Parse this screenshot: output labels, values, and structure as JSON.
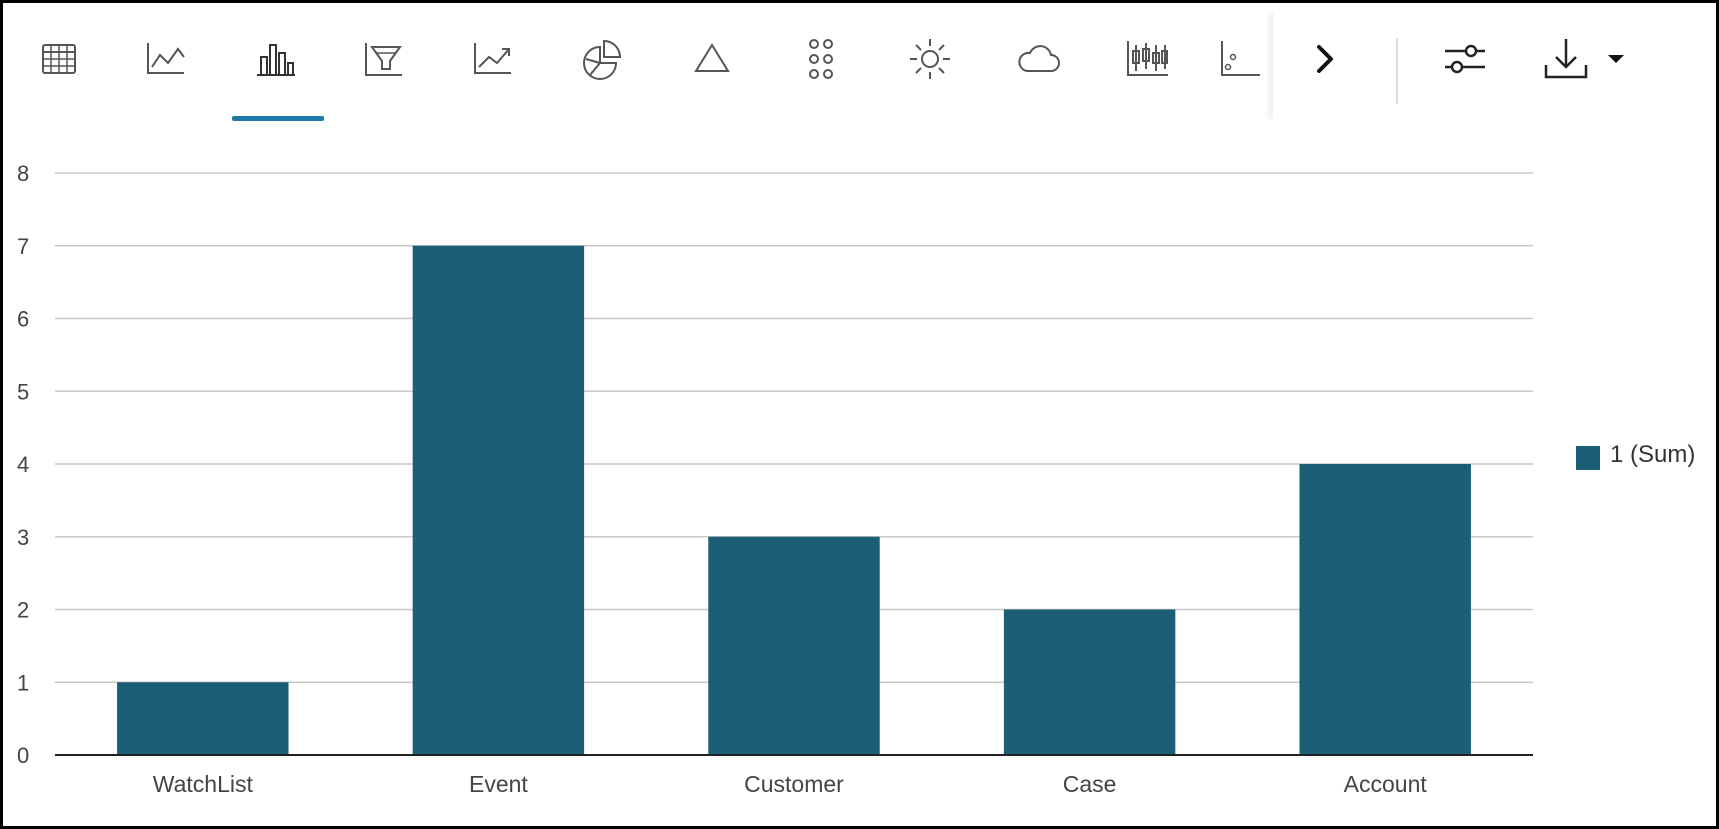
{
  "toolbar": {
    "buttons": [
      {
        "icon": "table-icon",
        "label": "Table"
      },
      {
        "icon": "line-chart-icon",
        "label": "Line"
      },
      {
        "icon": "bar-chart-icon",
        "label": "Bar"
      },
      {
        "icon": "funnel-icon",
        "label": "Funnel"
      },
      {
        "icon": "trend-chart-icon",
        "label": "Trend"
      },
      {
        "icon": "pie-chart-icon",
        "label": "Pie"
      },
      {
        "icon": "pyramid-icon",
        "label": "Pyramid"
      },
      {
        "icon": "dot-grid-icon",
        "label": "Bubble grid"
      },
      {
        "icon": "sunburst-icon",
        "label": "Sunburst"
      },
      {
        "icon": "tag-cloud-icon",
        "label": "Tag cloud"
      },
      {
        "icon": "stock-chart-icon",
        "label": "Stock"
      },
      {
        "icon": "scatter-chart-icon",
        "label": "Scatter"
      }
    ],
    "active": "bar-chart-icon",
    "right_buttons": [
      {
        "icon": "chevron-right-icon"
      },
      {
        "icon": "settings-sliders-icon"
      },
      {
        "icon": "download-icon"
      },
      {
        "icon": "caret-down-icon"
      }
    ]
  },
  "colors": {
    "bar": "#1b5e75",
    "accent": "#1b7aa6",
    "grid": "#c8c8c8",
    "axis": "#222222",
    "icon": "#555555"
  },
  "chart_data": {
    "type": "bar",
    "categories": [
      "WatchList",
      "Event",
      "Customer",
      "Case",
      "Account"
    ],
    "series": [
      {
        "name": "1 (Sum)",
        "values": [
          1,
          7,
          3,
          2,
          4
        ]
      }
    ],
    "yticks": [
      "0",
      "1",
      "2",
      "3",
      "4",
      "5",
      "6",
      "7",
      "8"
    ],
    "ylim": [
      0,
      8
    ],
    "grid": true,
    "legend": "right"
  }
}
